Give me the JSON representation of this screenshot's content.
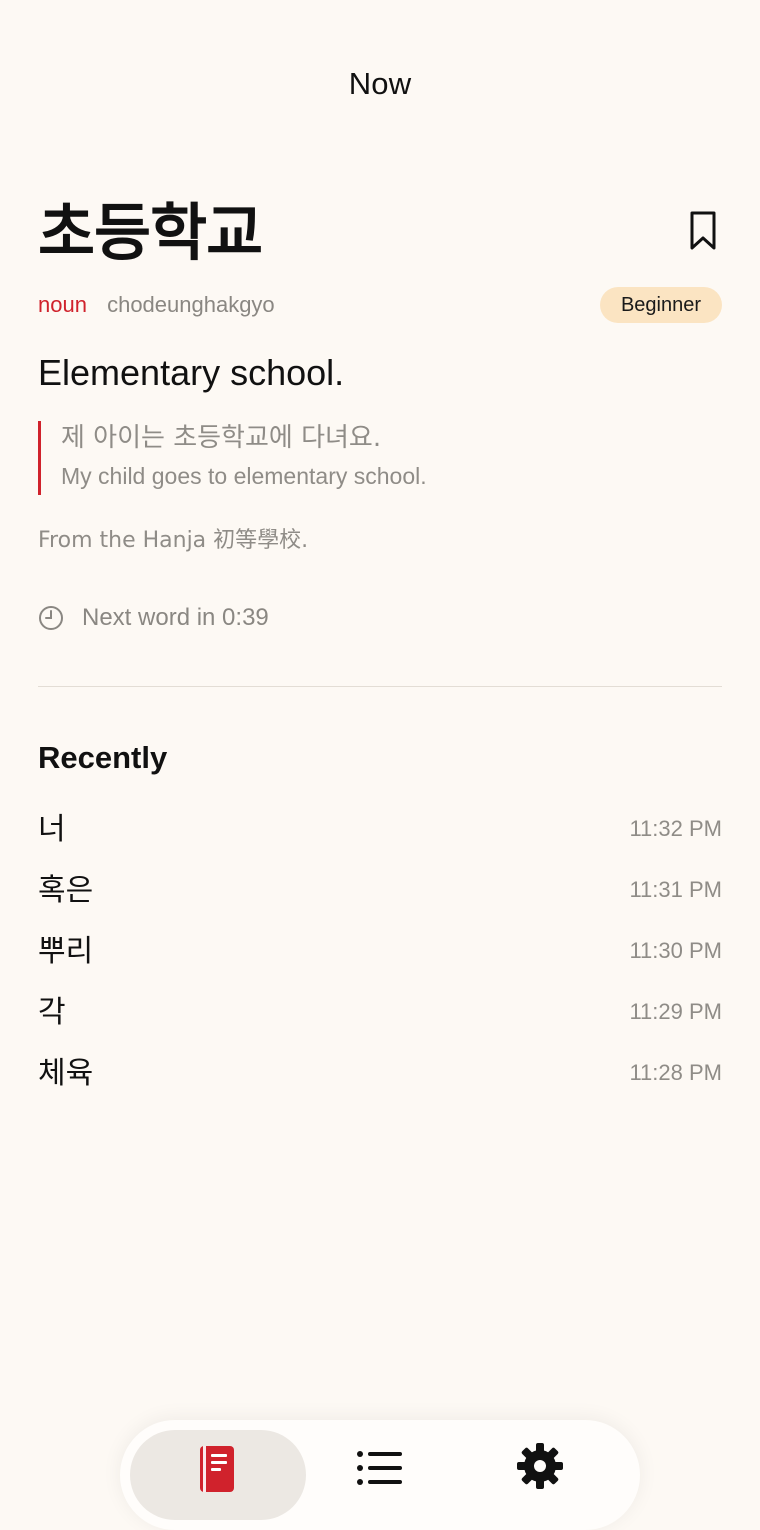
{
  "header": {
    "title": "Now"
  },
  "word": {
    "hangul": "초등학교",
    "part_of_speech": "noun",
    "romanization": "chodeunghakgyo",
    "level": "Beginner",
    "definition": "Elementary school.",
    "example_korean": "제 아이는 초등학교에 다녀요.",
    "example_english": "My child goes to elementary school.",
    "etymology": "From the Hanja 初等學校."
  },
  "timer": {
    "text": "Next word in 0:39"
  },
  "recently": {
    "heading": "Recently",
    "items": [
      {
        "word": "너",
        "time": "11:32 PM"
      },
      {
        "word": "혹은",
        "time": "11:31 PM"
      },
      {
        "word": "뿌리",
        "time": "11:30 PM"
      },
      {
        "word": "각",
        "time": "11:29 PM"
      },
      {
        "word": "체육",
        "time": "11:28 PM"
      }
    ]
  },
  "tabs": [
    {
      "icon": "book-icon",
      "active": true
    },
    {
      "icon": "list-icon",
      "active": false
    },
    {
      "icon": "gear-icon",
      "active": false
    }
  ],
  "colors": {
    "accent": "#d0222c",
    "background": "#fdf9f4",
    "badge": "#fbe4c2"
  }
}
